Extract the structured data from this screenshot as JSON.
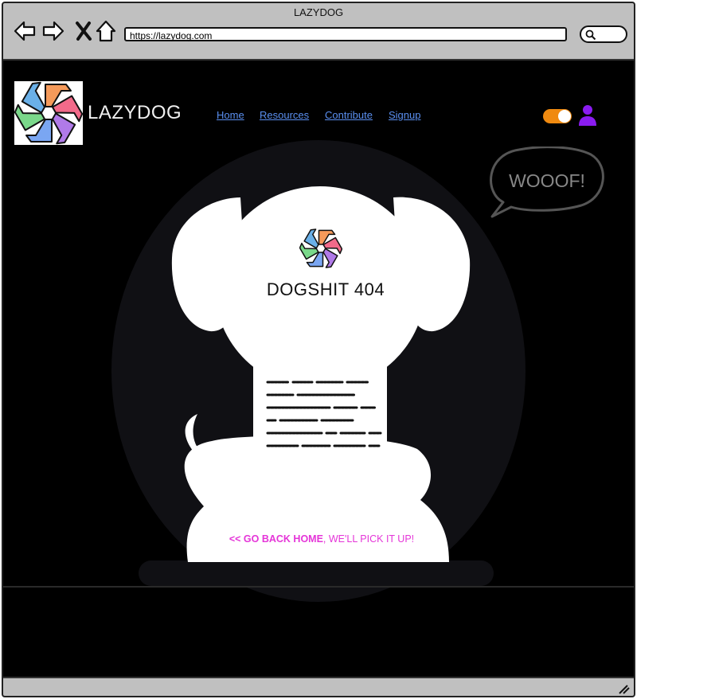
{
  "window": {
    "title": "LAZYDOG"
  },
  "browser": {
    "url": "https://lazydog.com"
  },
  "header": {
    "brand": "LAZYDOG",
    "nav": [
      {
        "label": "Home"
      },
      {
        "label": "Resources"
      },
      {
        "label": "Contribute"
      },
      {
        "label": "Signup"
      }
    ]
  },
  "bubble": {
    "text": "WOOOF!"
  },
  "error": {
    "title": "DOGSHIT 404",
    "link_text": "<< GO BACK HOME",
    "link_suffix": ", WE'LL PICK IT UP!"
  },
  "colors": {
    "accent_link": "#5a8ff0",
    "toggle": "#f08a10",
    "user_icon": "#8a1cf0",
    "cta": "#e535d8"
  }
}
